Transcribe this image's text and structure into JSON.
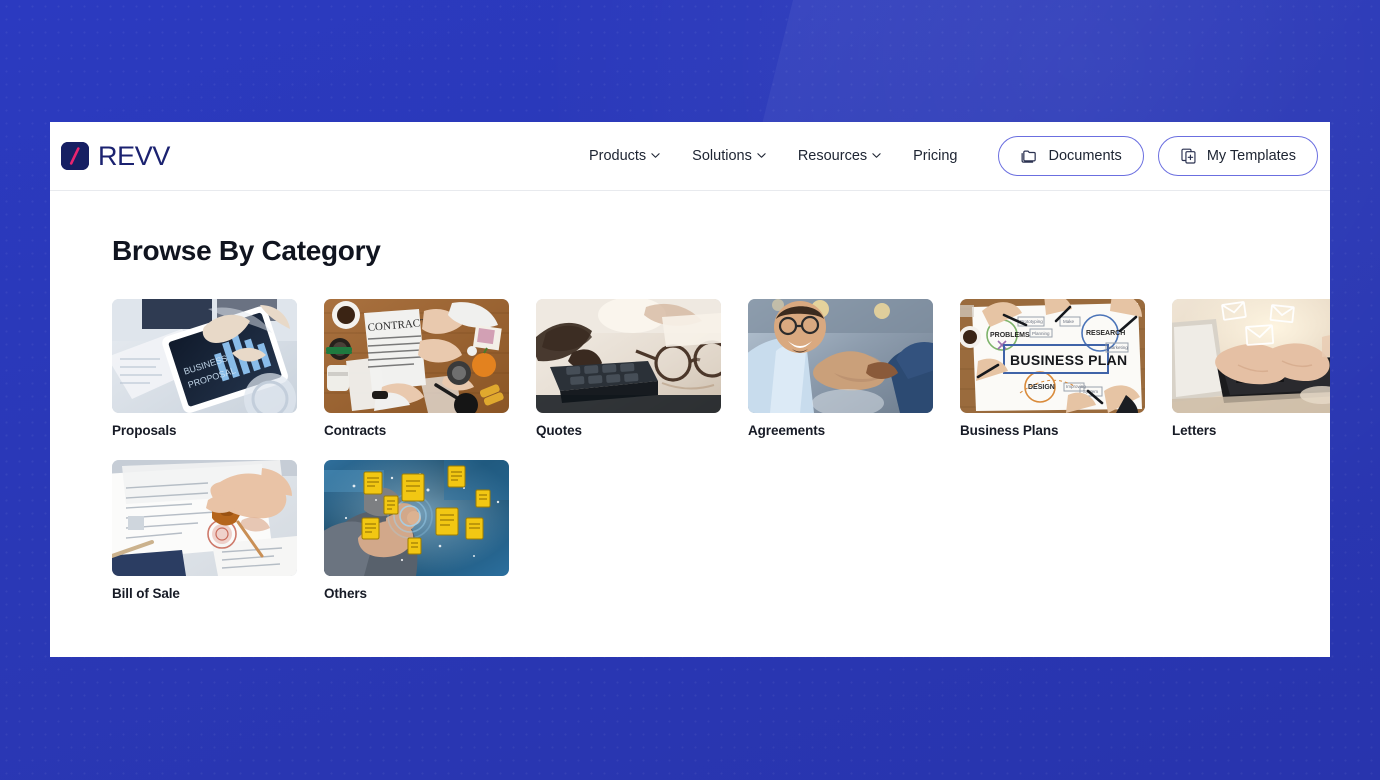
{
  "brand": {
    "name": "REVV",
    "mark_icon": "slash-logo-icon",
    "mark_bg": "#161f63",
    "slash_color": "#e8246f"
  },
  "header": {
    "nav": [
      {
        "label": "Products",
        "has_caret": true,
        "caret_icon": "chevron-down-icon"
      },
      {
        "label": "Solutions",
        "has_caret": true,
        "caret_icon": "chevron-down-icon"
      },
      {
        "label": "Resources",
        "has_caret": true,
        "caret_icon": "chevron-down-icon"
      },
      {
        "label": "Pricing",
        "has_caret": false,
        "caret_icon": ""
      }
    ],
    "buttons": [
      {
        "label": "Documents",
        "icon": "folder-copy-icon"
      },
      {
        "label": "My Templates",
        "icon": "copy-add-icon"
      }
    ],
    "border_color": "#e8eaee",
    "pill_border_color": "#6b6fe0"
  },
  "main": {
    "title": "Browse By Category",
    "categories": [
      {
        "label": "Proposals",
        "thumb": "tablet-business-proposal-photo"
      },
      {
        "label": "Contracts",
        "thumb": "contract-desk-signing-photo"
      },
      {
        "label": "Quotes",
        "thumb": "calculator-glasses-photo"
      },
      {
        "label": "Agreements",
        "thumb": "handshake-photo"
      },
      {
        "label": "Business Plans",
        "thumb": "business-plan-whiteboard-photo"
      },
      {
        "label": "Letters",
        "thumb": "laptop-typing-email-photo"
      },
      {
        "label": "Bill of Sale",
        "thumb": "wax-seal-document-photo"
      },
      {
        "label": "Others",
        "thumb": "digital-documents-touch-photo"
      }
    ]
  },
  "theme": {
    "page_background": "#2a39b9",
    "card_background": "#ffffff",
    "text_primary": "#10141f",
    "brand_navy": "#1b2270"
  }
}
